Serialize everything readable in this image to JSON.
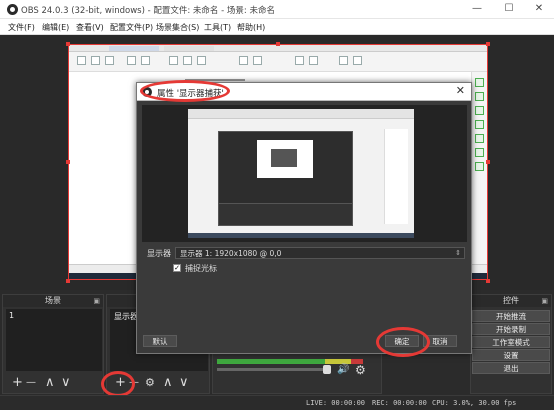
{
  "window": {
    "title": "OBS 24.0.3 (32-bit, windows) - 配置文件: 未命名 - 场景: 未命名",
    "minimize": "—",
    "maximize": "☐",
    "close": "✕"
  },
  "menu": {
    "items": [
      "文件(F)",
      "编辑(E)",
      "查看(V)",
      "配置文件(P)",
      "场景集合(S)",
      "工具(T)",
      "帮助(H)"
    ]
  },
  "dialog": {
    "title": "属性 '显示器捕获'",
    "close": "✕",
    "display_label": "显示器",
    "display_value": "显示器 1: 1920x1080 @ 0,0",
    "dropdown_arrow": "⇕",
    "capture_cursor_label": "捕捉光标",
    "capture_cursor_checked": true,
    "check_mark": "✓",
    "defaults_button": "默认",
    "ok_button": "确定",
    "cancel_button": "取消"
  },
  "scenes": {
    "title": "场景",
    "float_icon": "▣",
    "items": [
      "1"
    ],
    "add": "+",
    "remove": "—",
    "up": "∧",
    "down": "∨"
  },
  "sources": {
    "items": [
      "显示器"
    ],
    "add": "+",
    "remove": "—",
    "settings": "⚙",
    "up": "∧",
    "down": "∨"
  },
  "mixer": {
    "volume_icon": "🔊",
    "settings_icon": "⚙",
    "meter_colors": [
      "#3fa83f",
      "#c8c83a",
      "#c83a3a"
    ]
  },
  "controls": {
    "title": "控件",
    "float_icon": "▣",
    "buttons": [
      "开始推流",
      "开始录制",
      "工作室模式",
      "设置",
      "退出"
    ]
  },
  "status": {
    "live": "LIVE: 00:00:00",
    "rec": "REC: 00:00:00",
    "cpu": "CPU: 3.0%, 30.00 fps"
  },
  "colors": {
    "accent_red": "#e53935",
    "dark_bg": "#2b2b2b",
    "panel_bg": "#313131"
  }
}
